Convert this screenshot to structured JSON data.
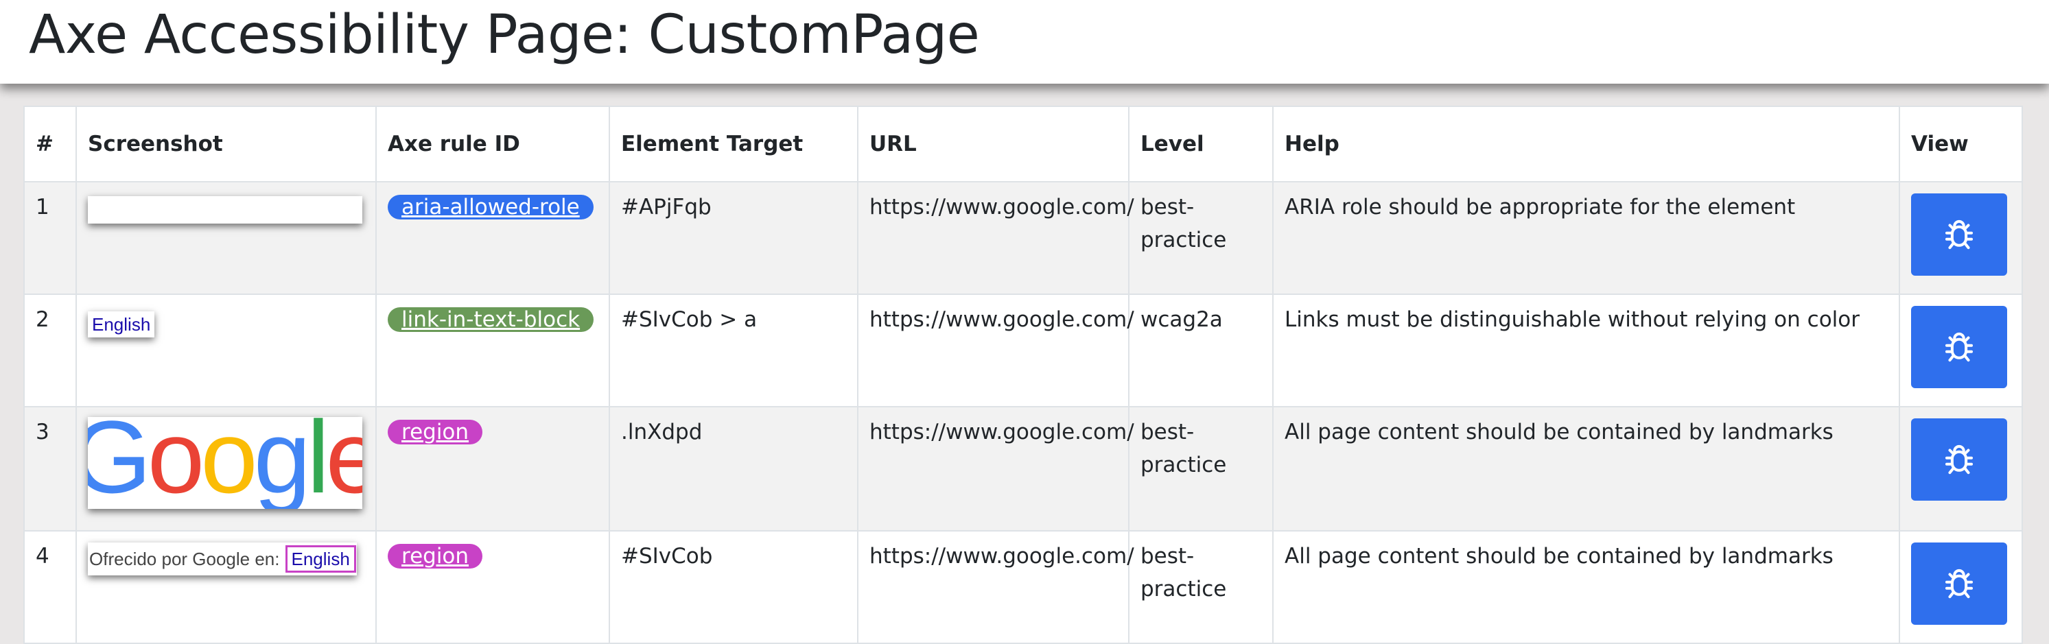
{
  "page": {
    "title": "Axe Accessibility Page: CustomPage"
  },
  "table": {
    "headers": [
      "#",
      "Screenshot",
      "Axe rule ID",
      "Element Target",
      "URL",
      "Level",
      "Help",
      "View"
    ],
    "rows": [
      {
        "num": "1",
        "screenshot": "",
        "rule_id": "aria-allowed-role",
        "rule_color": "#2f6fed",
        "target": "#APjFqb",
        "url": "https://www.google.com/",
        "level": "best-practice",
        "help": "ARIA role should be appropriate for the element",
        "view_icon": "bug-icon"
      },
      {
        "num": "2",
        "screenshot": "English",
        "rule_id": "link-in-text-block",
        "rule_color": "#6a9a58",
        "target": "#SIvCob > a",
        "url": "https://www.google.com/",
        "level": "wcag2a",
        "help": "Links must be distinguishable without relying on color",
        "view_icon": "bug-icon"
      },
      {
        "num": "3",
        "screenshot": "Google",
        "rule_id": "region",
        "rule_color": "#c842c6",
        "target": ".lnXdpd",
        "url": "https://www.google.com/",
        "level": "best-practice",
        "help": "All page content should be contained by landmarks",
        "view_icon": "bug-icon"
      },
      {
        "num": "4",
        "screenshot": "Ofrecido por Google en:",
        "screenshot_link": "English",
        "rule_id": "region",
        "rule_color": "#c842c6",
        "target": "#SIvCob",
        "url": "https://www.google.com/",
        "level": "best-practice",
        "help": "All page content should be contained by landmarks",
        "view_icon": "bug-icon"
      }
    ]
  },
  "colors": {
    "button_blue": "#2f6fed",
    "google_blue": "#4285f4",
    "google_red": "#ea4335",
    "google_yellow": "#fbbc05",
    "google_green": "#34a853"
  }
}
